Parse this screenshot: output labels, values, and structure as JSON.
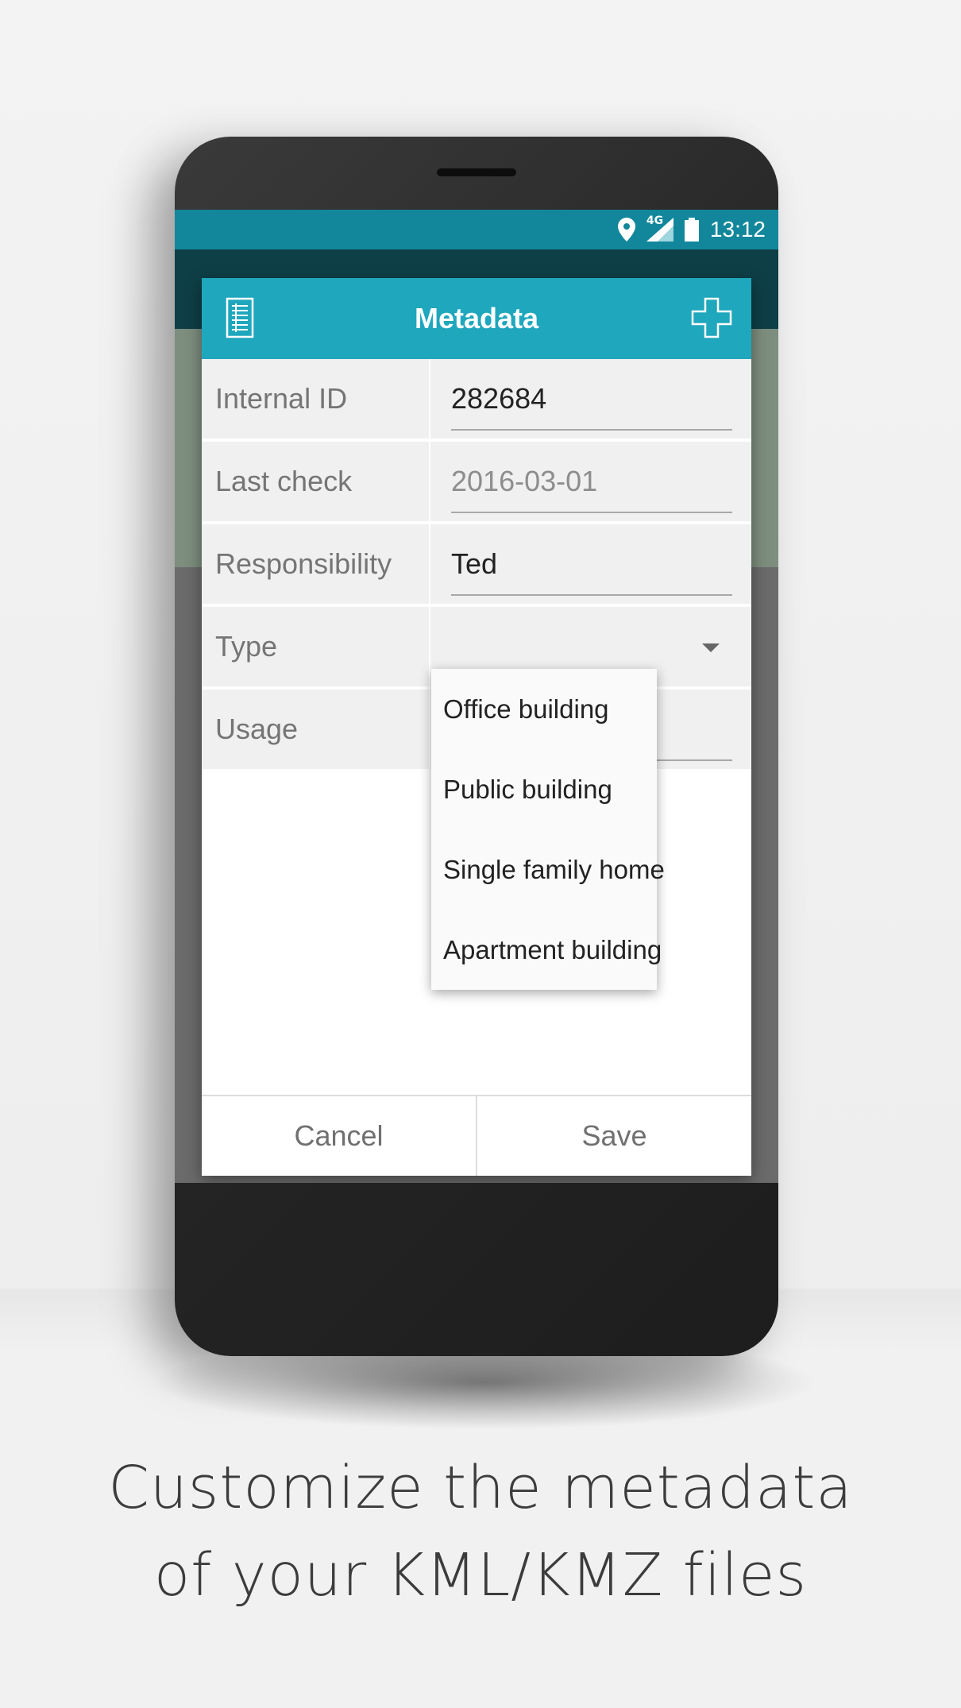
{
  "status_bar": {
    "time": "13:12",
    "network": "4G",
    "icons": [
      "location-icon",
      "signal-icon",
      "battery-icon"
    ]
  },
  "dialog": {
    "title": "Metadata",
    "header_icons": [
      "list-icon",
      "add-icon"
    ],
    "fields": [
      {
        "label": "Internal ID",
        "value": "282684",
        "placeholder": false
      },
      {
        "label": "Last check",
        "value": "2016-03-01",
        "placeholder": true
      },
      {
        "label": "Responsibility",
        "value": "Ted",
        "placeholder": false
      },
      {
        "label": "Type",
        "value": ""
      },
      {
        "label": "Usage",
        "value": ""
      }
    ],
    "cancel_label": "Cancel",
    "save_label": "Save"
  },
  "type_dropdown": {
    "options": [
      "Office building",
      "Public building",
      "Single family home",
      "Apartment building"
    ]
  },
  "nav_bar": {
    "buttons": [
      "back-icon",
      "home-icon",
      "recents-icon"
    ]
  },
  "caption": {
    "line1": "Customize the metadata",
    "line2": "of your KML/KMZ files"
  },
  "colors": {
    "accent": "#1fa7bd",
    "status_bar": "#12879b"
  }
}
